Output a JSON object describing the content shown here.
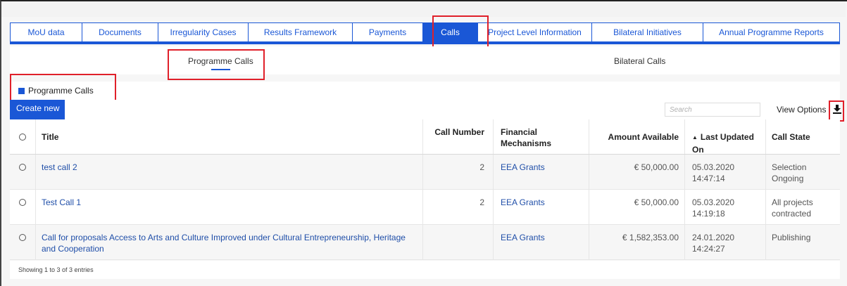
{
  "tabs": [
    {
      "label": "MoU data",
      "active": false
    },
    {
      "label": "Documents",
      "active": false
    },
    {
      "label": "Irregularity Cases",
      "active": false
    },
    {
      "label": "Results Framework",
      "active": false
    },
    {
      "label": "Payments",
      "active": false
    },
    {
      "label": "Calls",
      "active": true
    },
    {
      "label": "Project Level Information",
      "active": false
    },
    {
      "label": "Bilateral Initiatives",
      "active": false
    },
    {
      "label": "Annual Programme Reports",
      "active": false
    }
  ],
  "subtabs": {
    "programme_calls": "Programme Calls",
    "bilateral_calls": "Bilateral Calls"
  },
  "panel": {
    "title": "Programme Calls"
  },
  "toolbar": {
    "create_label": "Create new",
    "search_placeholder": "Search",
    "view_options_label": "View Options",
    "download_icon": "download-icon"
  },
  "table": {
    "headers": {
      "title": "Title",
      "call_number": "Call Number",
      "financial_mechanisms": "Financial Mechanisms",
      "amount_available": "Amount Available",
      "last_updated_on": "Last Updated On",
      "call_state": "Call State"
    },
    "rows": [
      {
        "title": "test call 2",
        "call_number": "2",
        "financial_mechanisms": "EEA Grants",
        "amount_available": "€ 50,000.00",
        "last_updated_date": "05.03.2020",
        "last_updated_time": "14:47:14",
        "call_state": "Selection Ongoing"
      },
      {
        "title": "Test Call 1",
        "call_number": "2",
        "financial_mechanisms": "EEA Grants",
        "amount_available": "€ 50,000.00",
        "last_updated_date": "05.03.2020",
        "last_updated_time": "14:19:18",
        "call_state": "All projects contracted"
      },
      {
        "title": "Call for proposals Access to Arts and Culture Improved under Cultural Entrepreneurship, Heritage and Cooperation",
        "call_number": "",
        "financial_mechanisms": "EEA Grants",
        "amount_available": "€ 1,582,353.00",
        "last_updated_date": "24.01.2020",
        "last_updated_time": "14:24:27",
        "call_state": "Publishing"
      }
    ]
  },
  "footer": {
    "entries_info": "Showing 1 to 3 of 3 entries"
  },
  "colors": {
    "accent": "#1a57d6",
    "highlight": "#e0202a"
  }
}
